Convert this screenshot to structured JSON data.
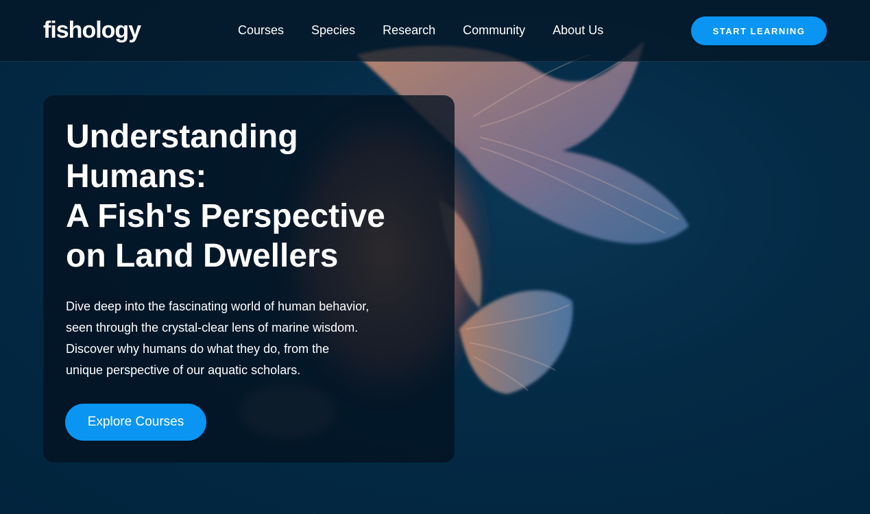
{
  "header": {
    "logo": "fishology",
    "nav": [
      {
        "label": "Courses"
      },
      {
        "label": "Species"
      },
      {
        "label": "Research"
      },
      {
        "label": "Community"
      },
      {
        "label": "About Us"
      }
    ],
    "cta_label": "START LEARNING"
  },
  "hero": {
    "title_lines": [
      "Understanding",
      "Humans:",
      "A Fish's Perspective",
      "on Land Dwellers"
    ],
    "description_lines": [
      "Dive deep into the fascinating world of human behavior,",
      "seen through the crystal-clear lens of marine wisdom.",
      "Discover why humans do what they do, from the",
      "unique perspective of our aquatic scholars."
    ],
    "button_label": "Explore Courses"
  },
  "colors": {
    "accent": "#0a95f2",
    "background": "#03263f",
    "header_bg": "#041626"
  },
  "background_image": {
    "icon": "goldfish-image"
  }
}
